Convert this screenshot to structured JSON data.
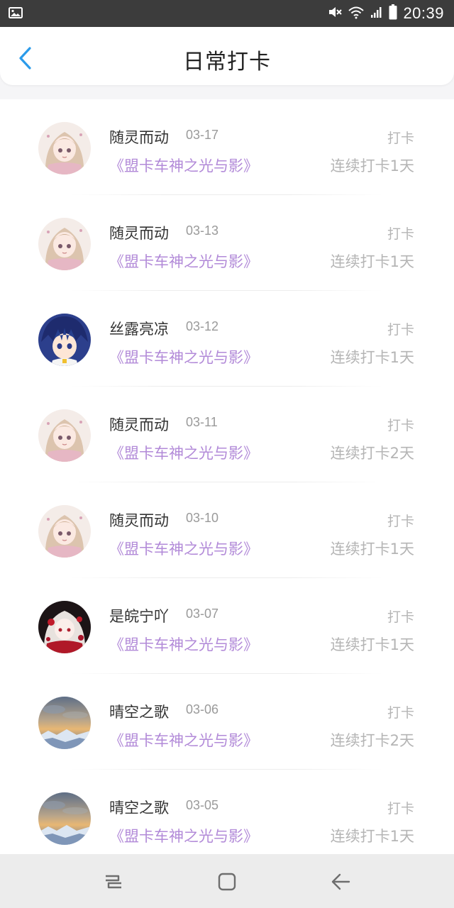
{
  "status_bar": {
    "time": "20:39",
    "icons": [
      "image-icon",
      "mute-icon",
      "wifi-icon",
      "signal-icon",
      "battery-icon"
    ]
  },
  "header": {
    "title": "日常打卡",
    "back_icon": "chevron-left-icon",
    "accent": "#2b9bea"
  },
  "colors": {
    "book_title": "#b28ad8",
    "muted": "#b5b5b5"
  },
  "entries": [
    {
      "name": "随灵而动",
      "date": "03-17",
      "tag": "打卡",
      "book": "《盟卡车神之光与影》",
      "streak": "连续打卡1天",
      "avatar": "anime-girl-beige"
    },
    {
      "name": "随灵而动",
      "date": "03-13",
      "tag": "打卡",
      "book": "《盟卡车神之光与影》",
      "streak": "连续打卡1天",
      "avatar": "anime-girl-beige"
    },
    {
      "name": "丝露亮凉",
      "date": "03-12",
      "tag": "打卡",
      "book": "《盟卡车神之光与影》",
      "streak": "连续打卡1天",
      "avatar": "anime-boy-blue"
    },
    {
      "name": "随灵而动",
      "date": "03-11",
      "tag": "打卡",
      "book": "《盟卡车神之光与影》",
      "streak": "连续打卡2天",
      "avatar": "anime-girl-beige"
    },
    {
      "name": "随灵而动",
      "date": "03-10",
      "tag": "打卡",
      "book": "《盟卡车神之光与影》",
      "streak": "连续打卡1天",
      "avatar": "anime-girl-beige"
    },
    {
      "name": "是皖宁吖",
      "date": "03-07",
      "tag": "打卡",
      "book": "《盟卡车神之光与影》",
      "streak": "连续打卡1天",
      "avatar": "anime-girl-red"
    },
    {
      "name": "晴空之歌",
      "date": "03-06",
      "tag": "打卡",
      "book": "《盟卡车神之光与影》",
      "streak": "连续打卡2天",
      "avatar": "sky-landscape"
    },
    {
      "name": "晴空之歌",
      "date": "03-05",
      "tag": "打卡",
      "book": "《盟卡车神之光与影》",
      "streak": "连续打卡1天",
      "avatar": "sky-landscape"
    }
  ],
  "nav_bar": {
    "icons": [
      "recents-icon",
      "home-icon",
      "back-arrow-icon"
    ]
  }
}
